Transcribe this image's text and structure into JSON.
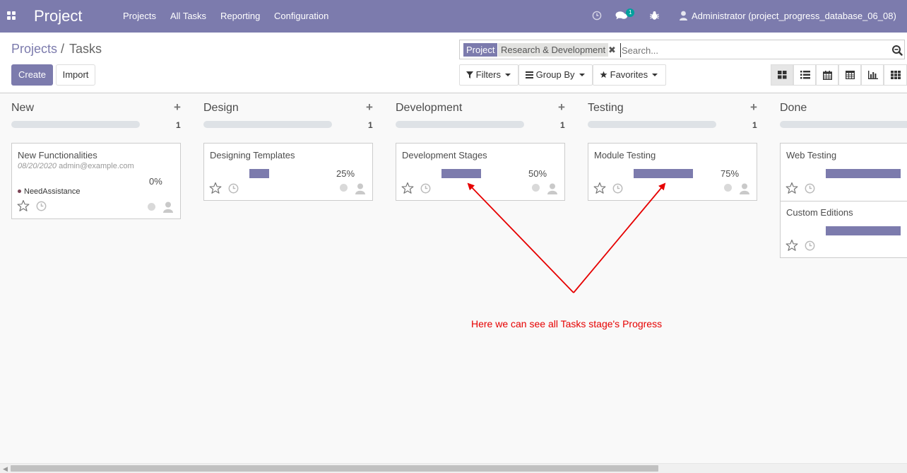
{
  "navbar": {
    "brand": "Project",
    "menu": [
      "Projects",
      "All Tasks",
      "Reporting",
      "Configuration"
    ],
    "messages_badge": "1",
    "user": "Administrator (project_progress_database_06_08)"
  },
  "breadcrumb": {
    "parent": "Projects",
    "separator": "/",
    "current": "Tasks"
  },
  "actions": {
    "create": "Create",
    "import": "Import"
  },
  "search": {
    "facet_field": "Project",
    "facet_value": "Research & Development",
    "placeholder": "Search..."
  },
  "filters": {
    "filters": "Filters",
    "group_by": "Group By",
    "favorites": "Favorites"
  },
  "views": [
    "kanban-icon",
    "list-icon",
    "calendar-icon",
    "pivot-icon",
    "graph-icon",
    "grid-icon"
  ],
  "columns": [
    {
      "title": "New",
      "count": "1",
      "add": "+"
    },
    {
      "title": "Design",
      "count": "1",
      "add": "+"
    },
    {
      "title": "Development",
      "count": "1",
      "add": "+"
    },
    {
      "title": "Testing",
      "count": "1",
      "add": "+"
    },
    {
      "title": "Done",
      "count": "",
      "add": ""
    }
  ],
  "cards": [
    {
      "title": "New Functionalities",
      "date": "08/20/2020",
      "email": "admin@example.com",
      "progress_label": "0%",
      "progress": 0,
      "tag": "NeedAssistance"
    },
    {
      "title": "Designing Templates",
      "progress_label": "25%",
      "progress": 25
    },
    {
      "title": "Development Stages",
      "progress_label": "50%",
      "progress": 50
    },
    {
      "title": "Module Testing",
      "progress_label": "75%",
      "progress": 75
    },
    {
      "title": "Web Testing",
      "progress_label": "",
      "progress": 100
    },
    {
      "title": "Custom Editions",
      "progress_label": "",
      "progress": 100
    }
  ],
  "annotation": "Here we can see all Tasks stage's Progress",
  "colors": {
    "brand": "#7c7bad",
    "annotation": "#e60000"
  }
}
